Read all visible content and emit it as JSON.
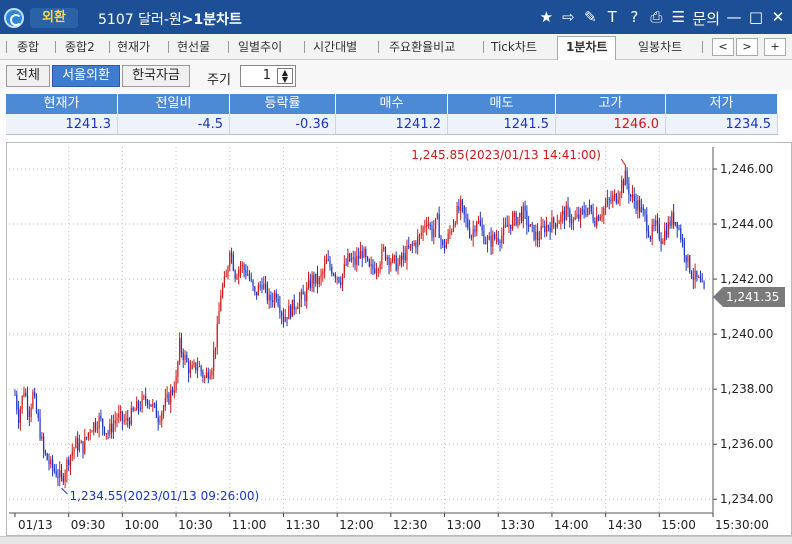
{
  "titlebar": {
    "badge": "외환",
    "code_title": "5107 달러-원",
    "screen_name": "1분차트",
    "icons": [
      "star-icon",
      "export-icon",
      "link-icon",
      "text-icon",
      "help-icon",
      "print-icon",
      "list-icon"
    ],
    "inquiry": "문의",
    "min": "—",
    "max": "□",
    "close": "✕"
  },
  "tabs": {
    "items": [
      "종합",
      "종합2",
      "현재가",
      "현선물",
      "일별추이",
      "시간대별",
      "주요환율비교",
      "Tick차트",
      "1분차트",
      "일봉차트"
    ],
    "active": "1분차트",
    "prev": "<",
    "next": ">",
    "add": "+"
  },
  "toolbar": {
    "market_buttons": [
      "전체",
      "서울외환",
      "한국자금"
    ],
    "selected_market": "서울외환",
    "period_label": "주기",
    "period_value": "1",
    "spin_up": "▲",
    "spin_down": "▼"
  },
  "quote": {
    "headers": [
      "현재가",
      "전일비",
      "등락률",
      "매수",
      "매도",
      "고가",
      "저가"
    ],
    "values": [
      "1241.3",
      "-4.5",
      "-0.36",
      "1241.2",
      "1241.5",
      "1246.0",
      "1234.5"
    ],
    "value_colors": [
      "blue",
      "blue",
      "blue",
      "blue",
      "blue",
      "red",
      "blue"
    ]
  },
  "chart_data": {
    "type": "candlestick",
    "title": "",
    "xlabel": "",
    "ylabel": "",
    "ylim": [
      1233.5,
      1246.8
    ],
    "y_ticks": [
      "1,246.00",
      "1,244.00",
      "1,242.00",
      "1,240.00",
      "1,238.00",
      "1,236.00",
      "1,234.00"
    ],
    "y_tick_values": [
      1246,
      1244,
      1242,
      1240,
      1238,
      1236,
      1234
    ],
    "x_ticks": [
      "01/13",
      "09:30",
      "10:00",
      "10:30",
      "11:00",
      "11:30",
      "12:00",
      "12:30",
      "13:00",
      "13:30",
      "14:00",
      "14:30",
      "15:00",
      "15:30:00"
    ],
    "x_tick_times": [
      "09:00",
      "09:30",
      "10:00",
      "10:30",
      "11:00",
      "11:30",
      "12:00",
      "12:30",
      "13:00",
      "13:30",
      "14:00",
      "14:30",
      "15:00",
      "15:30"
    ],
    "x_range": [
      "09:00",
      "15:30"
    ],
    "current_price_label": "1,241.35",
    "current_price": 1241.35,
    "annotations": [
      {
        "text": "1,245.85(2023/01/13 14:41:00)",
        "time": "14:41",
        "value": 1245.85,
        "color": "#d01818"
      },
      {
        "text": "1,234.55(2023/01/13 09:26:00)",
        "time": "09:26",
        "value": 1234.55,
        "color": "#1a34c8"
      }
    ],
    "up_color": "#d01818",
    "down_color": "#1a34c8",
    "grid": "dotted vertical and horizontal",
    "path_points": [
      [
        "09:00",
        1237.8
      ],
      [
        "09:02",
        1237.0
      ],
      [
        "09:05",
        1238.0
      ],
      [
        "09:08",
        1237.2
      ],
      [
        "09:10",
        1237.8
      ],
      [
        "09:13",
        1236.8
      ],
      [
        "09:16",
        1235.7
      ],
      [
        "09:20",
        1235.2
      ],
      [
        "09:24",
        1234.9
      ],
      [
        "09:26",
        1234.7
      ],
      [
        "09:30",
        1235.5
      ],
      [
        "09:34",
        1236.0
      ],
      [
        "09:38",
        1235.9
      ],
      [
        "09:42",
        1236.6
      ],
      [
        "09:47",
        1236.9
      ],
      [
        "09:52",
        1236.4
      ],
      [
        "09:57",
        1237.0
      ],
      [
        "10:02",
        1236.8
      ],
      [
        "10:08",
        1237.3
      ],
      [
        "10:14",
        1237.7
      ],
      [
        "10:20",
        1237.0
      ],
      [
        "10:26",
        1237.7
      ],
      [
        "10:30",
        1238.3
      ],
      [
        "10:32",
        1239.6
      ],
      [
        "10:35",
        1239.1
      ],
      [
        "10:38",
        1238.6
      ],
      [
        "10:42",
        1238.9
      ],
      [
        "10:46",
        1238.4
      ],
      [
        "10:50",
        1238.9
      ],
      [
        "10:53",
        1240.1
      ],
      [
        "10:55",
        1241.5
      ],
      [
        "10:58",
        1242.0
      ],
      [
        "11:00",
        1243.2
      ],
      [
        "11:03",
        1242.2
      ],
      [
        "11:06",
        1242.5
      ],
      [
        "11:10",
        1242.2
      ],
      [
        "11:14",
        1241.4
      ],
      [
        "11:18",
        1241.9
      ],
      [
        "11:22",
        1241.2
      ],
      [
        "11:26",
        1241.5
      ],
      [
        "11:30",
        1240.6
      ],
      [
        "11:34",
        1240.9
      ],
      [
        "11:38",
        1241.2
      ],
      [
        "11:42",
        1241.4
      ],
      [
        "11:46",
        1242.0
      ],
      [
        "11:50",
        1241.9
      ],
      [
        "11:54",
        1242.6
      ],
      [
        "11:58",
        1242.3
      ],
      [
        "12:02",
        1242.0
      ],
      [
        "12:06",
        1242.7
      ],
      [
        "12:10",
        1242.6
      ],
      [
        "12:14",
        1243.0
      ],
      [
        "12:18",
        1242.3
      ],
      [
        "12:22",
        1242.5
      ],
      [
        "12:26",
        1243.0
      ],
      [
        "12:30",
        1242.7
      ],
      [
        "12:34",
        1242.5
      ],
      [
        "12:38",
        1242.9
      ],
      [
        "12:42",
        1243.2
      ],
      [
        "12:46",
        1243.5
      ],
      [
        "12:50",
        1244.2
      ],
      [
        "12:53",
        1243.7
      ],
      [
        "12:56",
        1244.1
      ],
      [
        "12:59",
        1243.1
      ],
      [
        "13:02",
        1243.5
      ],
      [
        "13:06",
        1244.3
      ],
      [
        "13:09",
        1244.6
      ],
      [
        "13:12",
        1244.1
      ],
      [
        "13:15",
        1243.6
      ],
      [
        "13:18",
        1244.2
      ],
      [
        "13:21",
        1243.7
      ],
      [
        "13:24",
        1243.3
      ],
      [
        "13:28",
        1243.5
      ],
      [
        "13:32",
        1243.6
      ],
      [
        "13:36",
        1244.0
      ],
      [
        "13:40",
        1244.2
      ],
      [
        "13:44",
        1244.4
      ],
      [
        "13:48",
        1243.8
      ],
      [
        "13:52",
        1243.5
      ],
      [
        "13:56",
        1243.9
      ],
      [
        "14:00",
        1244.0
      ],
      [
        "14:04",
        1244.2
      ],
      [
        "14:08",
        1244.4
      ],
      [
        "14:12",
        1244.1
      ],
      [
        "14:16",
        1244.3
      ],
      [
        "14:20",
        1244.6
      ],
      [
        "14:24",
        1244.2
      ],
      [
        "14:28",
        1244.5
      ],
      [
        "14:32",
        1244.8
      ],
      [
        "14:36",
        1245.0
      ],
      [
        "14:39",
        1245.5
      ],
      [
        "14:41",
        1245.7
      ],
      [
        "14:44",
        1245.0
      ],
      [
        "14:48",
        1244.7
      ],
      [
        "14:52",
        1244.2
      ],
      [
        "14:55",
        1243.6
      ],
      [
        "14:58",
        1243.9
      ],
      [
        "15:01",
        1243.5
      ],
      [
        "15:04",
        1243.8
      ],
      [
        "15:07",
        1244.2
      ],
      [
        "15:10",
        1244.1
      ],
      [
        "15:13",
        1243.3
      ],
      [
        "15:16",
        1242.6
      ],
      [
        "15:19",
        1242.1
      ],
      [
        "15:22",
        1241.9
      ],
      [
        "15:25",
        1241.5
      ]
    ]
  }
}
